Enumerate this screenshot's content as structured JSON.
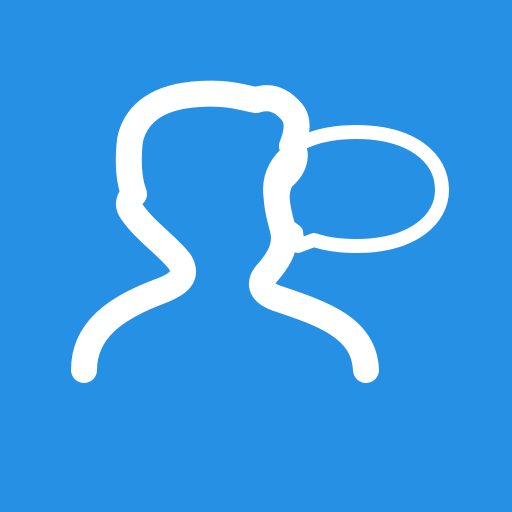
{
  "icon": {
    "name": "person-speech-bubble-icon",
    "background_color": "#2690e4",
    "glyph_color": "#ffffff"
  }
}
